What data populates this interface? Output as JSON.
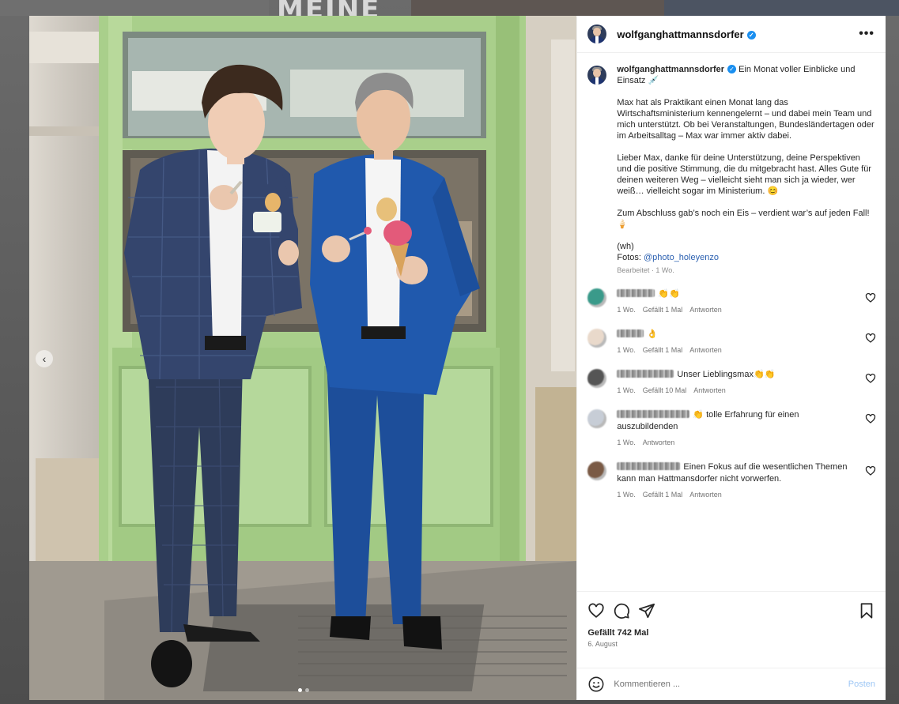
{
  "backdrop": {
    "sign_text": "MEINE"
  },
  "post": {
    "username": "wolfganghattmannsdorfer",
    "verified_glyph": "✓",
    "more_glyph": "•••",
    "caption": {
      "headline": "Ein Monat voller Einblicke und Einsatz",
      "headline_emoji": "💉",
      "paragraphs": [
        "Max hat als Praktikant einen Monat lang das Wirtschaftsministerium kennengelernt – und dabei mein Team und mich unterstützt. Ob bei Veranstaltungen, Bundesländertagen oder im Arbeitsalltag – Max war immer aktiv dabei.",
        "Lieber Max, danke für deine Unterstützung, deine Perspektiven und die positive Stimmung, die du mitgebracht hast. Alles Gute für deinen weiteren Weg – vielleicht sieht man sich ja wieder, wer weiß… vielleicht sogar im Ministerium. 😊",
        "Zum Abschluss gab’s noch ein Eis – verdient war’s auf jeden Fall! 🍦"
      ],
      "signoff": "(wh)",
      "photo_credit_label": "Fotos:",
      "photo_credit_handle": "@photo_holeyenzo",
      "meta": "Bearbeitet · 1 Wo."
    },
    "comments": [
      {
        "text": "👏👏",
        "time": "1 Wo.",
        "likes": "Gefällt 1 Mal",
        "reply": "Antworten",
        "avatar_color": "#3a9a8a",
        "user_width": 48
      },
      {
        "text": "👌",
        "time": "1 Wo.",
        "likes": "Gefällt 1 Mal",
        "reply": "Antworten",
        "avatar_color": "#e9d9cb",
        "user_width": 34
      },
      {
        "text": "Unser Lieblingsmax👏👏",
        "time": "1 Wo.",
        "likes": "Gefällt 10 Mal",
        "reply": "Antworten",
        "avatar_color": "#555555",
        "user_width": 72
      },
      {
        "text": "👏 tolle Erfahrung für einen auszubildenden",
        "time": "1 Wo.",
        "likes": "",
        "reply": "Antworten",
        "avatar_color": "#c7cdd6",
        "user_width": 92
      },
      {
        "text": "Einen Fokus auf die wesentlichen Themen kann man Hattmansdorfer nicht vorwerfen.",
        "time": "1 Wo.",
        "likes": "Gefällt 1 Mal",
        "reply": "Antworten",
        "avatar_color": "#7a5a45",
        "user_width": 80
      }
    ],
    "likes_label": "Gefällt 742 Mal",
    "date_label": "6. August",
    "comment_placeholder": "Kommentieren ...",
    "post_button": "Posten",
    "icons": [
      "heart-icon",
      "comment-icon",
      "share-icon",
      "bookmark-icon",
      "emoji-icon",
      "chevron-left-icon"
    ],
    "colors": {
      "link": "#2a5fb0",
      "verified": "#1a8ff0",
      "door_green": "#a9cf8b",
      "suit_blue": "#1d4e9a"
    }
  }
}
